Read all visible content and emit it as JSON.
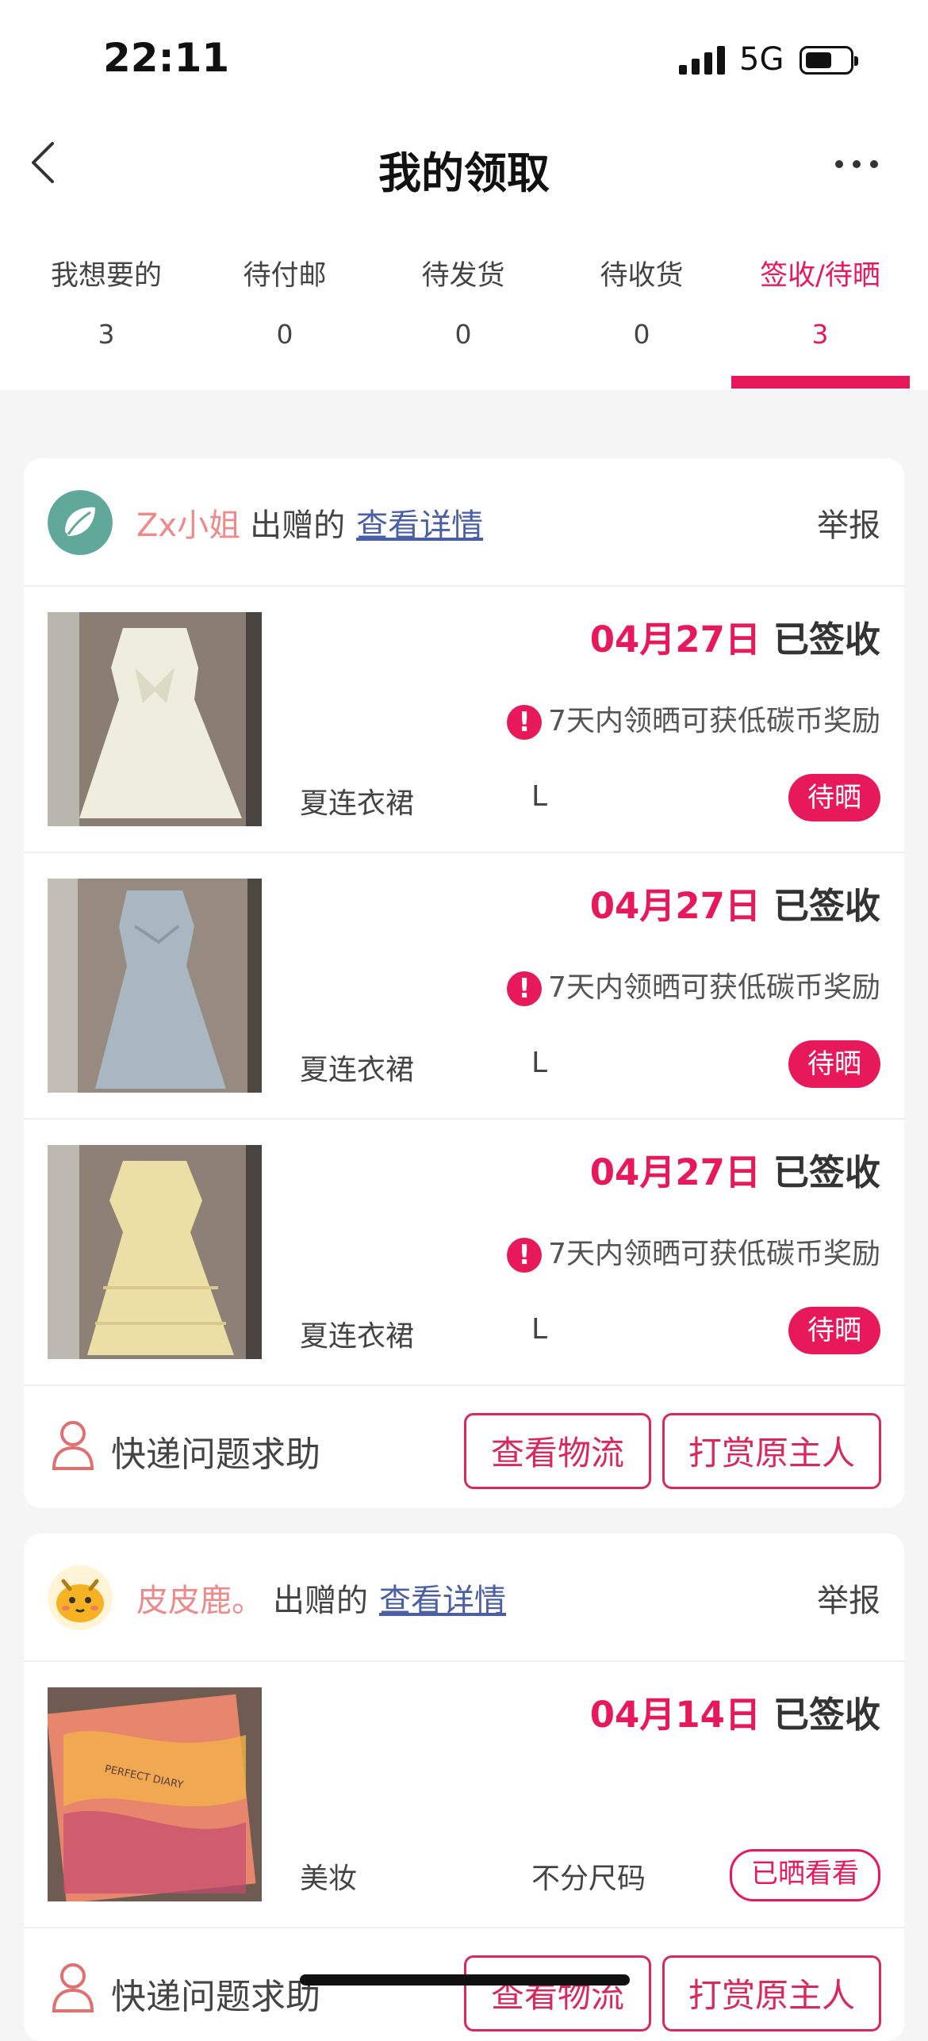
{
  "status_bar": {
    "time": "22:11",
    "network": "5G"
  },
  "header": {
    "title": "我的领取",
    "back_icon": "chevron-left-icon",
    "more_icon": "more-icon"
  },
  "tabs": [
    {
      "label": "我想要的",
      "count": "3"
    },
    {
      "label": "待付邮",
      "count": "0"
    },
    {
      "label": "待发货",
      "count": "0"
    },
    {
      "label": "待收货",
      "count": "0"
    },
    {
      "label": "签收/待晒",
      "count": "3"
    }
  ],
  "active_tab": "签收/待晒",
  "colors": {
    "accent": "#e8195a",
    "nickname": "#f08a8a",
    "link": "#4a5fa6"
  },
  "orders": [
    {
      "nickname": "Zx小姐",
      "gives_label": "出赠的",
      "details_label": "查看详情",
      "report_label": "举报",
      "items": [
        {
          "date": "04月27日",
          "status": "已签收",
          "hint": "7天内领晒可获低碳币奖励",
          "category": "夏连衣裙",
          "size": "L",
          "badge": "待晒"
        },
        {
          "date": "04月27日",
          "status": "已签收",
          "hint": "7天内领晒可获低碳币奖励",
          "category": "夏连衣裙",
          "size": "L",
          "badge": "待晒"
        },
        {
          "date": "04月27日",
          "status": "已签收",
          "hint": "7天内领晒可获低碳币奖励",
          "category": "夏连衣裙",
          "size": "L",
          "badge": "待晒"
        }
      ],
      "help_label": "快递问题求助",
      "logistics_label": "查看物流",
      "tip_label": "打赏原主人"
    },
    {
      "nickname": "皮皮鹿。",
      "gives_label": "出赠的",
      "details_label": "查看详情",
      "report_label": "举报",
      "items": [
        {
          "date": "04月14日",
          "status": "已签收",
          "category": "美妆",
          "size": "不分尺码",
          "badge": "已晒看看",
          "thumb_text": "PERFECT DIARY"
        }
      ],
      "help_label": "快递问题求助",
      "logistics_label": "查看物流",
      "tip_label": "打赏原主人"
    }
  ]
}
